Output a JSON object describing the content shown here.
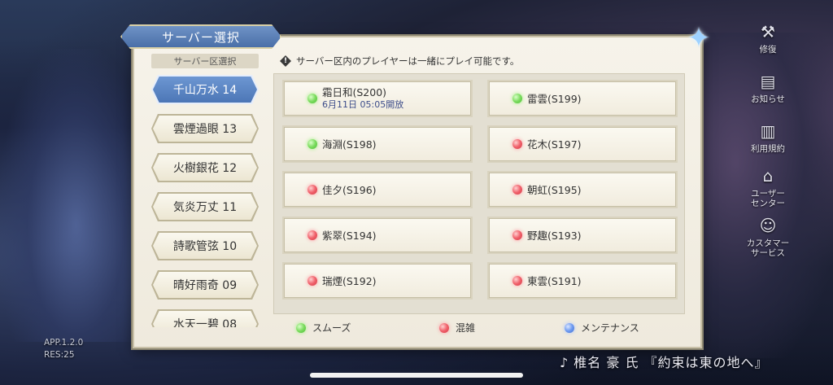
{
  "dialog": {
    "title": "サーバー選択",
    "group_header": "サーバー区選択",
    "notice": "サーバー区内のプレイヤーは一緒にプレイ可能です。",
    "notice_icon": "info-icon",
    "close_icon": "star-close-icon"
  },
  "groups": [
    {
      "label": "千山万水 14",
      "active": true
    },
    {
      "label": "雲煙過眼 13",
      "active": false
    },
    {
      "label": "火樹銀花 12",
      "active": false
    },
    {
      "label": "気炎万丈 11",
      "active": false
    },
    {
      "label": "詩歌管弦 10",
      "active": false
    },
    {
      "label": "晴好雨奇 09",
      "active": false
    },
    {
      "label": "水天一碧 08",
      "active": false
    }
  ],
  "servers": [
    {
      "name": "霜日和(S200)",
      "sub": "6月11日 05:05開放",
      "status": "green"
    },
    {
      "name": "雷雲(S199)",
      "sub": "",
      "status": "green"
    },
    {
      "name": "海淵(S198)",
      "sub": "",
      "status": "green"
    },
    {
      "name": "花木(S197)",
      "sub": "",
      "status": "red"
    },
    {
      "name": "佳夕(S196)",
      "sub": "",
      "status": "red"
    },
    {
      "name": "朝虹(S195)",
      "sub": "",
      "status": "red"
    },
    {
      "name": "紫翠(S194)",
      "sub": "",
      "status": "red"
    },
    {
      "name": "野趣(S193)",
      "sub": "",
      "status": "red"
    },
    {
      "name": "瑞煙(S192)",
      "sub": "",
      "status": "red"
    },
    {
      "name": "東雲(S191)",
      "sub": "",
      "status": "red"
    }
  ],
  "legend": {
    "smooth": "スムーズ",
    "busy": "混雑",
    "maintenance": "メンテナンス"
  },
  "status_colors": {
    "green": "#6fd552",
    "red": "#e44b57",
    "blue": "#5b86e6"
  },
  "side_menu": [
    {
      "label": "修復",
      "icon": "repair-icon"
    },
    {
      "label": "お知らせ",
      "icon": "notice-board-icon"
    },
    {
      "label": "利用規約",
      "icon": "book-icon"
    },
    {
      "label": "ユーザー\nセンター",
      "icon": "user-center-icon"
    },
    {
      "label": "カスタマー\nサービス",
      "icon": "customer-service-icon"
    }
  ],
  "footer": {
    "version": "APP.1.2.0",
    "res": "RES:25",
    "music": "♪ 椎名 豪 氏 『約束は東の地へ』"
  }
}
